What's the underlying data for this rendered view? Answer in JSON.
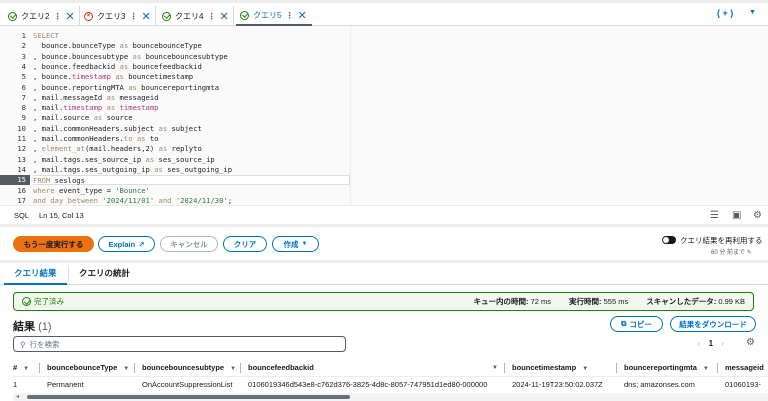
{
  "tabs": [
    {
      "label": "クエリ2",
      "status": "success"
    },
    {
      "label": "クエリ3",
      "status": "error"
    },
    {
      "label": "クエリ4",
      "status": "success"
    },
    {
      "label": "クエリ5",
      "status": "success",
      "active": true
    }
  ],
  "tabbar": {
    "add_label": "( + )",
    "menu_icon": "caret-down"
  },
  "editor": {
    "current_line": 15,
    "lines": [
      [
        {
          "t": "SELECT",
          "k": "kw"
        }
      ],
      [
        {
          "t": "  bounce.bounceType ",
          "k": "id"
        },
        {
          "t": "as",
          "k": "kw"
        },
        {
          "t": " bouncebounceType",
          "k": "id"
        }
      ],
      [
        {
          "t": ", bounce.bouncesubtype ",
          "k": "id"
        },
        {
          "t": "as",
          "k": "kw"
        },
        {
          "t": " bouncebouncesubtype",
          "k": "id"
        }
      ],
      [
        {
          "t": ", bounce.feedbackid ",
          "k": "id"
        },
        {
          "t": "as",
          "k": "kw"
        },
        {
          "t": " bouncefeedbackid",
          "k": "id"
        }
      ],
      [
        {
          "t": ", bounce.",
          "k": "id"
        },
        {
          "t": "timestamp",
          "k": "fn"
        },
        {
          "t": " as",
          "k": "kw"
        },
        {
          "t": " bouncetimestamp",
          "k": "id"
        }
      ],
      [
        {
          "t": ", bounce.reportingMTA ",
          "k": "id"
        },
        {
          "t": "as",
          "k": "kw"
        },
        {
          "t": " bouncereportingmta",
          "k": "id"
        }
      ],
      [
        {
          "t": ", mail.messageId ",
          "k": "id"
        },
        {
          "t": "as",
          "k": "kw"
        },
        {
          "t": " messageid",
          "k": "id"
        }
      ],
      [
        {
          "t": ", mail.",
          "k": "id"
        },
        {
          "t": "timestamp",
          "k": "fn"
        },
        {
          "t": " as ",
          "k": "kw"
        },
        {
          "t": "timestamp",
          "k": "fn"
        }
      ],
      [
        {
          "t": ", mail.source ",
          "k": "id"
        },
        {
          "t": "as",
          "k": "kw"
        },
        {
          "t": " source",
          "k": "id"
        }
      ],
      [
        {
          "t": ", mail.commonHeaders.subject ",
          "k": "id"
        },
        {
          "t": "as",
          "k": "kw"
        },
        {
          "t": " subject",
          "k": "id"
        }
      ],
      [
        {
          "t": ", mail.commonHeaders.",
          "k": "id"
        },
        {
          "t": "to as",
          "k": "kw"
        },
        {
          "t": " to",
          "k": "id"
        }
      ],
      [
        {
          "t": ", ",
          "k": "id"
        },
        {
          "t": "element_at",
          "k": "kw"
        },
        {
          "t": "(mail.headers,2) ",
          "k": "id"
        },
        {
          "t": "as",
          "k": "kw"
        },
        {
          "t": " replyto",
          "k": "id"
        }
      ],
      [
        {
          "t": ", mail.tags.ses_source_ip ",
          "k": "id"
        },
        {
          "t": "as",
          "k": "kw"
        },
        {
          "t": " ses_source_ip",
          "k": "id"
        }
      ],
      [
        {
          "t": ", mail.tags.ses_outgoing_ip ",
          "k": "id"
        },
        {
          "t": "as",
          "k": "kw"
        },
        {
          "t": " ses_outgoing_ip",
          "k": "id"
        }
      ],
      [
        {
          "t": "FROM",
          "k": "kw"
        },
        {
          "t": " seslogs",
          "k": "id"
        }
      ],
      [
        {
          "t": "where",
          "k": "kw"
        },
        {
          "t": " event_type = ",
          "k": "id"
        },
        {
          "t": "'Bounce'",
          "k": "str"
        }
      ],
      [
        {
          "t": "and day between ",
          "k": "kw"
        },
        {
          "t": "'2024/11/01'",
          "k": "str"
        },
        {
          "t": " and ",
          "k": "kw"
        },
        {
          "t": "'2024/11/30'",
          "k": "str"
        },
        {
          "t": ";",
          "k": "id"
        }
      ]
    ]
  },
  "statusbar": {
    "language": "SQL",
    "cursor": "Ln 15, Col 13"
  },
  "actions": {
    "run_again": "もう一度実行する",
    "explain": "Explain",
    "cancel": "キャンセル",
    "clear": "クリア",
    "create": "作成"
  },
  "reuse": {
    "label": "クエリ結果を再利用する",
    "sub": "60 分 前まで",
    "enabled": true
  },
  "result_tabs": [
    "クエリ結果",
    "クエリの統計"
  ],
  "status": {
    "label": "完了済み",
    "queue_label": "キュー内の時間:",
    "queue_value": "72 ms",
    "run_label": "実行時間:",
    "run_value": "555 ms",
    "scan_label": "スキャンしたデータ:",
    "scan_value": "0.99 KB"
  },
  "results": {
    "title": "結果",
    "count": "(1)",
    "copy": "コピー",
    "download": "結果をダウンロード",
    "search_placeholder": "行を検索",
    "page": "1",
    "columns": [
      "#",
      "bouncebounceType",
      "bouncebouncesubtype",
      "bouncefeedbackid",
      "bouncetimestamp",
      "bouncereportingmta",
      "messageid"
    ],
    "rows": [
      [
        "1",
        "Permanent",
        "OnAccountSuppressionList",
        "0106019346d543e8-c762d376-3825-4d8c-8057-747951d1ed80-000000",
        "2024-11-19T23:50:02.037Z",
        "dns; amazonses.com",
        "01060193-"
      ]
    ]
  },
  "colors": {
    "accent": "#0073bb",
    "primary": "#ec7211",
    "success": "#1d8102",
    "error": "#d13212"
  }
}
